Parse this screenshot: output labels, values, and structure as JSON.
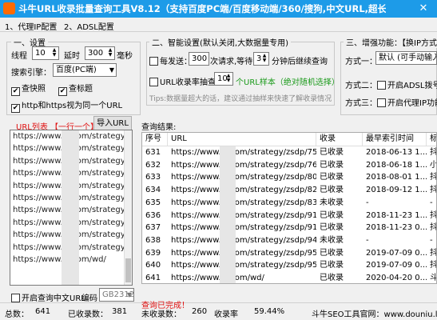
{
  "window": {
    "title": "斗牛URL收录批量查询工具V8.12（支持百度PC端/百度移动端/360/搜狗,中文URL,超长...",
    "close": "✕"
  },
  "menu": {
    "items": [
      "1、代理IP配置",
      "2、ADSL配置"
    ]
  },
  "settings": {
    "title": "一、设置",
    "threads_label": "线程",
    "threads_value": "10",
    "delay_label": "延时",
    "delay_value": "300",
    "delay_unit": "毫秒",
    "engine_label": "搜索引擎：",
    "engine_value": "百度(PC端)",
    "check_indexed": "查快照",
    "check_title": "查标题",
    "http_same": "http和https视为同一个URL"
  },
  "smart": {
    "title": "二、智能设置(默认关闭,大数据量专用)",
    "every_label": "每发送：",
    "every_value": "300",
    "requests_wait": "次请求,等待：",
    "wait_value": "3",
    "resume_label": "分钟后继续查询",
    "sample_label": "URL收录率抽查",
    "sample_value": "10",
    "sample_desc": "个URL样本（绝对随机选择）",
    "tip": "Tips:数据量超大的话，建议通过抽样来快速了解收录情况"
  },
  "enhance": {
    "title": "三、增强功能：【换IP方式】",
    "method1_label": "方式一：",
    "method1_value": "默认 (可手动输入百",
    "method2_label": "方式二：",
    "method2_check": "开启ADSL拨号",
    "method3_label": "方式三：",
    "method3_check": "开启代理IP功能"
  },
  "urllist": {
    "label": "URL列表 【一行一个】",
    "import_button": "导入URL",
    "lines": [
      "https://www.      z.com/strategy,",
      "https://www.      z.com/strategy,",
      "https://www.      z.com/strategy,",
      "https://www.      z.com/strategy,",
      "https://www.      z.com/strategy,",
      "https://www.      z.com/strategy,",
      "https://www.      z.com/strategy,",
      "https://www.      z.com/strategy,",
      "https://www.      z.com/strategy,",
      "https://www.      z.com/strategy,",
      "https://www.      z.com/wd/"
    ],
    "chinese_url": "开启查询中文URL",
    "encoding_label": "编码",
    "encoding_value": "GB2312"
  },
  "results": {
    "label": "查询结果:",
    "columns": [
      "序号",
      "URL",
      "收录",
      "最早索引时间",
      "标"
    ],
    "rows": [
      {
        "no": "631",
        "url": "https://www.      z.com/strategy/zsdp/75...",
        "status": "已收录",
        "date": "2018-06-13 1...",
        "t": "抖"
      },
      {
        "no": "632",
        "url": "https://www.      z.com/strategy/zsdp/76...",
        "status": "已收录",
        "date": "2018-06-18 1...",
        "t": "小"
      },
      {
        "no": "633",
        "url": "https://www.      z.com/strategy/zsdp/80...",
        "status": "已收录",
        "date": "2018-08-01 1...",
        "t": "抖"
      },
      {
        "no": "634",
        "url": "https://www.      z.com/strategy/zsdp/82...",
        "status": "已收录",
        "date": "2018-09-12 1...",
        "t": "抖"
      },
      {
        "no": "635",
        "url": "https://www.      z.com/strategy/zsdp/83...",
        "status": "未收录",
        "date": "-",
        "t": "-"
      },
      {
        "no": "636",
        "url": "https://www.      z.com/strategy/zsdp/91...",
        "status": "已收录",
        "date": "2018-11-23 1...",
        "t": "抖"
      },
      {
        "no": "637",
        "url": "https://www.      z.com/strategy/zsdp/91...",
        "status": "已收录",
        "date": "2018-11-23 0...",
        "t": "抖"
      },
      {
        "no": "638",
        "url": "https://www.      z.com/strategy/zsdp/94...",
        "status": "未收录",
        "date": "-",
        "t": "-"
      },
      {
        "no": "639",
        "url": "https://www.      z.com/strategy/zsdp/95...",
        "status": "已收录",
        "date": "2019-07-09 0...",
        "t": "抖"
      },
      {
        "no": "640",
        "url": "https://www.      z.com/strategy/zsdp/95...",
        "status": "已收录",
        "date": "2019-07-09 0...",
        "t": "抖"
      },
      {
        "no": "641",
        "url": "https://www.      z.com/wd/",
        "status": "已收录",
        "date": "2020-04-20 0...",
        "t": "斗"
      }
    ]
  },
  "statusbar": {
    "total_label": "总数：",
    "total": "641",
    "indexed_label": "已收录数：",
    "indexed": "381",
    "done_label": "查询已完成！",
    "unindexed_label": "未收录数：",
    "unindexed": "260",
    "rate_label": "收录率",
    "rate": "59.44%",
    "site": "斗牛SEO工具官网：www.douniu.la"
  },
  "colors": {
    "titlebar": "#1d9be8",
    "accent_red": "#e01010",
    "accent_green": "#1a9a1a"
  }
}
